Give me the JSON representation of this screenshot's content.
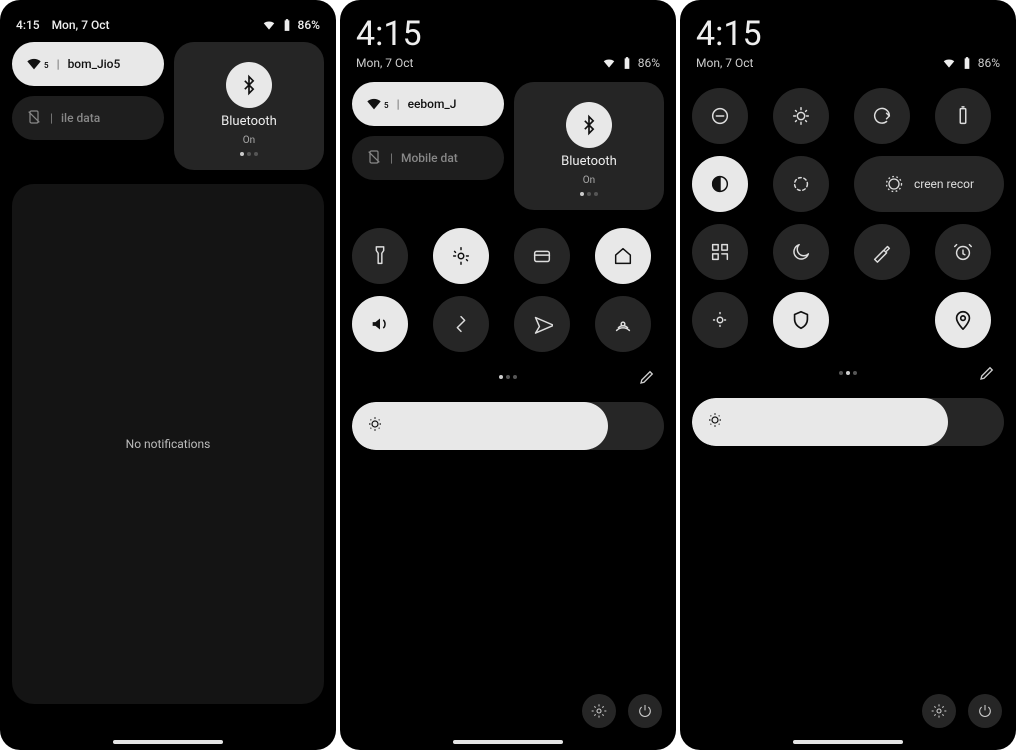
{
  "status": {
    "time": "4:15",
    "date": "Mon, 7 Oct",
    "battery": "86%"
  },
  "wifi": {
    "ssid_p1": "bom_Jio5",
    "ssid_p2": "eebom_J",
    "band": "5"
  },
  "mobile": {
    "label_p1": "ile data",
    "label_p2": "Mobile dat"
  },
  "bluetooth": {
    "label": "Bluetooth",
    "state": "On"
  },
  "notif": {
    "empty": "No notifications"
  },
  "record": {
    "label": "creen recor"
  },
  "page_dots": {
    "count": 3,
    "active_p1": 0,
    "active_p2": 0,
    "active_p3": 1
  }
}
